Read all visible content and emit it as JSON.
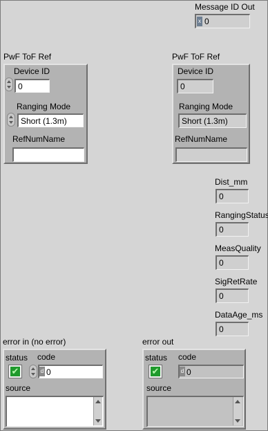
{
  "message_id_out": {
    "label": "Message ID Out",
    "value": "0",
    "radix": "x"
  },
  "ref_in": {
    "title": "PwF ToF Ref",
    "device_id_label": "Device ID",
    "device_id_value": "0",
    "ranging_mode_label": "Ranging Mode",
    "ranging_mode_value": "Short (1.3m)",
    "refnum_label": "RefNumName",
    "refnum_value": ""
  },
  "ref_out": {
    "title": "PwF ToF Ref",
    "device_id_label": "Device ID",
    "device_id_value": "0",
    "ranging_mode_label": "Ranging Mode",
    "ranging_mode_value": "Short (1.3m)",
    "refnum_label": "RefNumName",
    "refnum_value": ""
  },
  "indicators": {
    "dist_mm": {
      "label": "Dist_mm",
      "value": "0"
    },
    "ranging_status": {
      "label": "RangingStatus",
      "value": "0"
    },
    "meas_quality": {
      "label": "MeasQuality",
      "value": "0"
    },
    "sig_ret_rate": {
      "label": "SigRetRate",
      "value": "0"
    },
    "data_age_ms": {
      "label": "DataAge_ms",
      "value": "0"
    }
  },
  "error_in": {
    "title": "error in (no error)",
    "status_label": "status",
    "code_label": "code",
    "code_value": "0",
    "code_radix": "d",
    "source_label": "source",
    "source_value": "",
    "status_glyph": "✔"
  },
  "error_out": {
    "title": "error out",
    "status_label": "status",
    "code_label": "code",
    "code_value": "0",
    "code_radix": "d",
    "source_label": "source",
    "source_value": "",
    "status_glyph": "✔"
  },
  "colors": {
    "panel_bg": "#d5d5d5",
    "cluster_bg": "#b3b3b3",
    "led_green": "#1f9a2c"
  }
}
